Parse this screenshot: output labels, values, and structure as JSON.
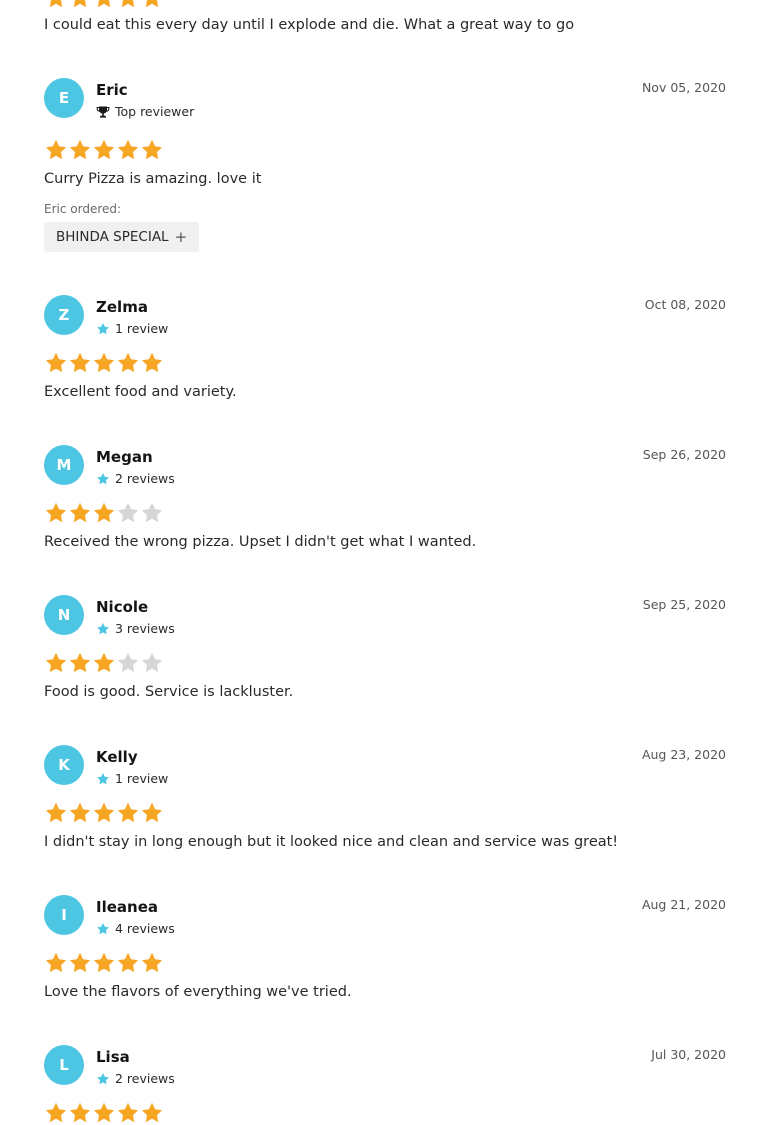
{
  "colors": {
    "avatar_bg": "#4cc6e3",
    "star_filled": "#f6a623",
    "star_empty": "#d6d6d6",
    "reviewer_star": "#4cc6e3"
  },
  "previous_review": {
    "rating": 5,
    "text": "I could eat this every day until I explode and die. What a great way to go"
  },
  "reviews": [
    {
      "initial": "E",
      "name": "Eric",
      "badge_icon": "trophy-icon",
      "badge_text": "Top reviewer",
      "date": "Nov 05, 2020",
      "rating": 5,
      "text": "Curry Pizza is amazing. love it",
      "ordered_label": "Eric ordered:",
      "ordered_item": "BHINDA SPECIAL",
      "ordered_item_icon": "plus-icon"
    },
    {
      "initial": "Z",
      "name": "Zelma",
      "badge_icon": "star-icon",
      "badge_text": "1 review",
      "date": "Oct 08, 2020",
      "rating": 5,
      "text": "Excellent food and variety."
    },
    {
      "initial": "M",
      "name": "Megan",
      "badge_icon": "star-icon",
      "badge_text": "2 reviews",
      "date": "Sep 26, 2020",
      "rating": 3,
      "text": "Received the wrong pizza. Upset I didn't get what I wanted."
    },
    {
      "initial": "N",
      "name": "Nicole",
      "badge_icon": "star-icon",
      "badge_text": "3 reviews",
      "date": "Sep 25, 2020",
      "rating": 3,
      "text": "Food is good. Service is lackluster."
    },
    {
      "initial": "K",
      "name": "Kelly",
      "badge_icon": "star-icon",
      "badge_text": "1 review",
      "date": "Aug 23, 2020",
      "rating": 5,
      "text": "I didn't stay in long enough but it looked nice and clean and service was great!"
    },
    {
      "initial": "I",
      "name": "Ileanea",
      "badge_icon": "star-icon",
      "badge_text": "4 reviews",
      "date": "Aug 21, 2020",
      "rating": 5,
      "text": "Love the flavors of everything we've tried."
    },
    {
      "initial": "L",
      "name": "Lisa",
      "badge_icon": "star-icon",
      "badge_text": "2 reviews",
      "date": "Jul 30, 2020",
      "rating": 5,
      "text": ""
    }
  ]
}
